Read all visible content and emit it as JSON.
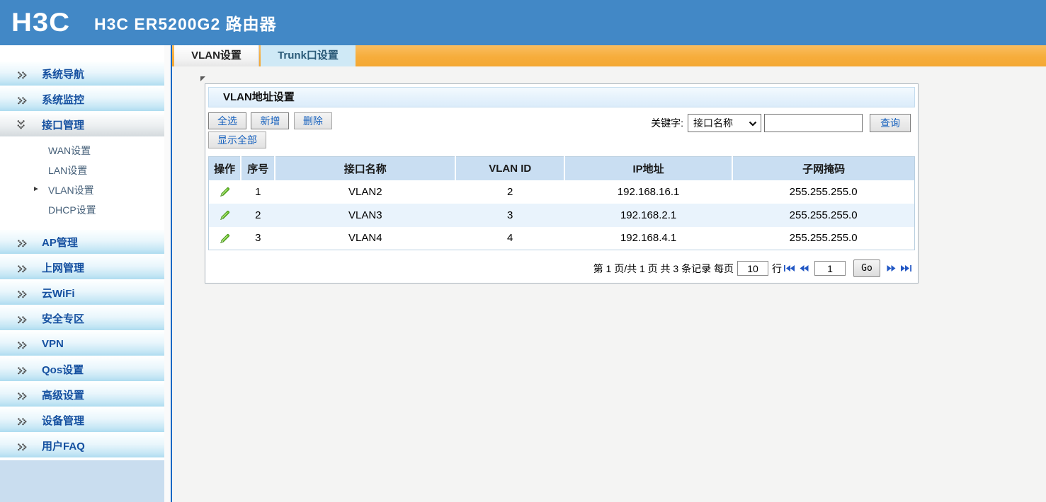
{
  "header": {
    "logo": "H3C",
    "title": "H3C ER5200G2 路由器"
  },
  "tabs": [
    {
      "label": "VLAN设置",
      "active": true
    },
    {
      "label": "Trunk口设置",
      "active": false
    }
  ],
  "sidebar": {
    "items": [
      {
        "label": "系统导航"
      },
      {
        "label": "系统监控"
      },
      {
        "label": "接口管理",
        "expanded": true
      },
      {
        "label": "AP管理"
      },
      {
        "label": "上网管理"
      },
      {
        "label": "云WiFi"
      },
      {
        "label": "安全专区"
      },
      {
        "label": "VPN"
      },
      {
        "label": "Qos设置"
      },
      {
        "label": "高级设置"
      },
      {
        "label": "设备管理"
      },
      {
        "label": "用户FAQ"
      }
    ],
    "submenu": [
      {
        "label": "WAN设置"
      },
      {
        "label": "LAN设置"
      },
      {
        "label": "VLAN设置",
        "selected": true
      },
      {
        "label": "DHCP设置"
      }
    ]
  },
  "panel": {
    "title": "VLAN地址设置",
    "toolbar": {
      "select_all": "全选",
      "add": "新增",
      "delete": "删除",
      "show_all": "显示全部"
    },
    "search": {
      "label": "关键字:",
      "field_selected": "接口名称",
      "input_value": "",
      "query": "查询"
    }
  },
  "table": {
    "headers": [
      "操作",
      "序号",
      "接口名称",
      "VLAN ID",
      "IP地址",
      "子网掩码"
    ],
    "rows": [
      {
        "seq": "1",
        "name": "VLAN2",
        "vlan_id": "2",
        "ip": "192.168.16.1",
        "mask": "255.255.255.0"
      },
      {
        "seq": "2",
        "name": "VLAN3",
        "vlan_id": "3",
        "ip": "192.168.2.1",
        "mask": "255.255.255.0"
      },
      {
        "seq": "3",
        "name": "VLAN4",
        "vlan_id": "4",
        "ip": "192.168.4.1",
        "mask": "255.255.255.0"
      }
    ]
  },
  "pagination": {
    "page_info": "第 1 页/共 1 页 共 3 条记录 每页",
    "rows_per_page": "10",
    "rows_suffix": "行",
    "goto_value": "1",
    "go_label": "Go"
  },
  "icons": {
    "sidebar_item": "double-chevron-right-dots",
    "sidebar_expanded": "double-chevron-down-dots",
    "submenu_selected": "arrow-right",
    "row_action": "pencil",
    "select_field": "chevron-down",
    "pagination": [
      "first-page",
      "prev-page",
      "next-page",
      "last-page"
    ]
  },
  "colors": {
    "header_blue": "#4288c6",
    "accent_orange": "#f5ab39",
    "link_blue": "#1560bd",
    "nav_text_blue": "#1550a0",
    "table_header_bg": "#c9def2",
    "row_alt_bg": "#e9f3fc",
    "divider_blue": "#1668c4",
    "pencil_green": "#6cc42a",
    "pager_arrow_blue": "#2257c4"
  }
}
